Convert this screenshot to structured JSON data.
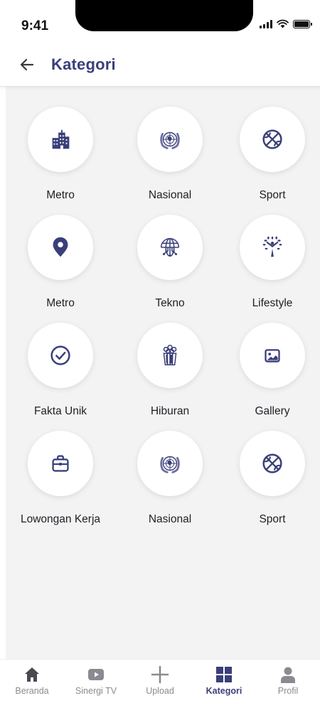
{
  "status_bar": {
    "time": "9:41"
  },
  "header": {
    "title": "Kategori"
  },
  "categories": [
    {
      "label": "Metro",
      "icon": "city-building-icon"
    },
    {
      "label": "Nasional",
      "icon": "un-emblem-icon"
    },
    {
      "label": "Sport",
      "icon": "basketball-icon"
    },
    {
      "label": "Metro",
      "icon": "location-pin-icon"
    },
    {
      "label": "Tekno",
      "icon": "tech-globe-icon"
    },
    {
      "label": "Lifestyle",
      "icon": "tree-person-icon"
    },
    {
      "label": "Fakta Unik",
      "icon": "check-circle-icon"
    },
    {
      "label": "Hiburan",
      "icon": "popcorn-icon"
    },
    {
      "label": "Gallery",
      "icon": "image-icon"
    },
    {
      "label": "Lowongan Kerja",
      "icon": "briefcase-icon"
    },
    {
      "label": "Nasional",
      "icon": "un-emblem-icon"
    },
    {
      "label": "Sport",
      "icon": "basketball-icon"
    }
  ],
  "bottom_nav": {
    "items": [
      {
        "label": "Beranda",
        "icon": "home-icon"
      },
      {
        "label": "Sinergi TV",
        "icon": "video-play-icon"
      },
      {
        "label": "Upload",
        "icon": "plus-icon"
      },
      {
        "label": "Kategori",
        "icon": "grid-icon",
        "active": true
      },
      {
        "label": "Profil",
        "icon": "user-icon"
      }
    ]
  },
  "colors": {
    "accent": "#3a3f7a",
    "background": "#f3f3f4",
    "inactive": "#8a8a90"
  }
}
